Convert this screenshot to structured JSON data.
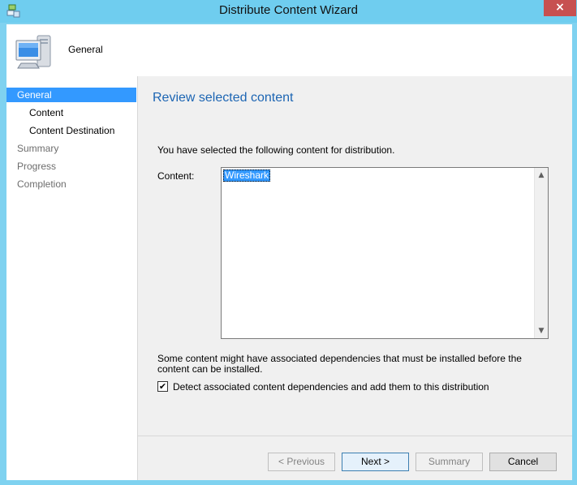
{
  "window": {
    "title": "Distribute Content Wizard",
    "close_glyph": "×"
  },
  "header": {
    "title": "General",
    "icon": "computer-icon"
  },
  "sidebar": {
    "items": [
      {
        "label": "General",
        "state": "selected"
      },
      {
        "label": "Content",
        "state": "sub"
      },
      {
        "label": "Content Destination",
        "state": "sub"
      },
      {
        "label": "Summary",
        "state": "dim"
      },
      {
        "label": "Progress",
        "state": "dim"
      },
      {
        "label": "Completion",
        "state": "dim"
      }
    ]
  },
  "main": {
    "title": "Review selected content",
    "intro": "You have selected the following content for distribution.",
    "content_label": "Content:",
    "content_items": [
      "Wireshark"
    ],
    "dependency_text": "Some content might have associated dependencies that must be installed before the content can be installed.",
    "checkbox": {
      "label": "Detect associated content dependencies and add them to this distribution",
      "checked": true,
      "glyph": "✔"
    }
  },
  "scrollbar": {
    "up_glyph": "▲",
    "down_glyph": "▼"
  },
  "buttons": {
    "previous": "< Previous",
    "next": "Next >",
    "summary": "Summary",
    "cancel": "Cancel"
  },
  "colors": {
    "selection": "#3399ff",
    "title_accent": "#1c65b3",
    "frame": "#6fcdef",
    "close": "#c75050"
  }
}
